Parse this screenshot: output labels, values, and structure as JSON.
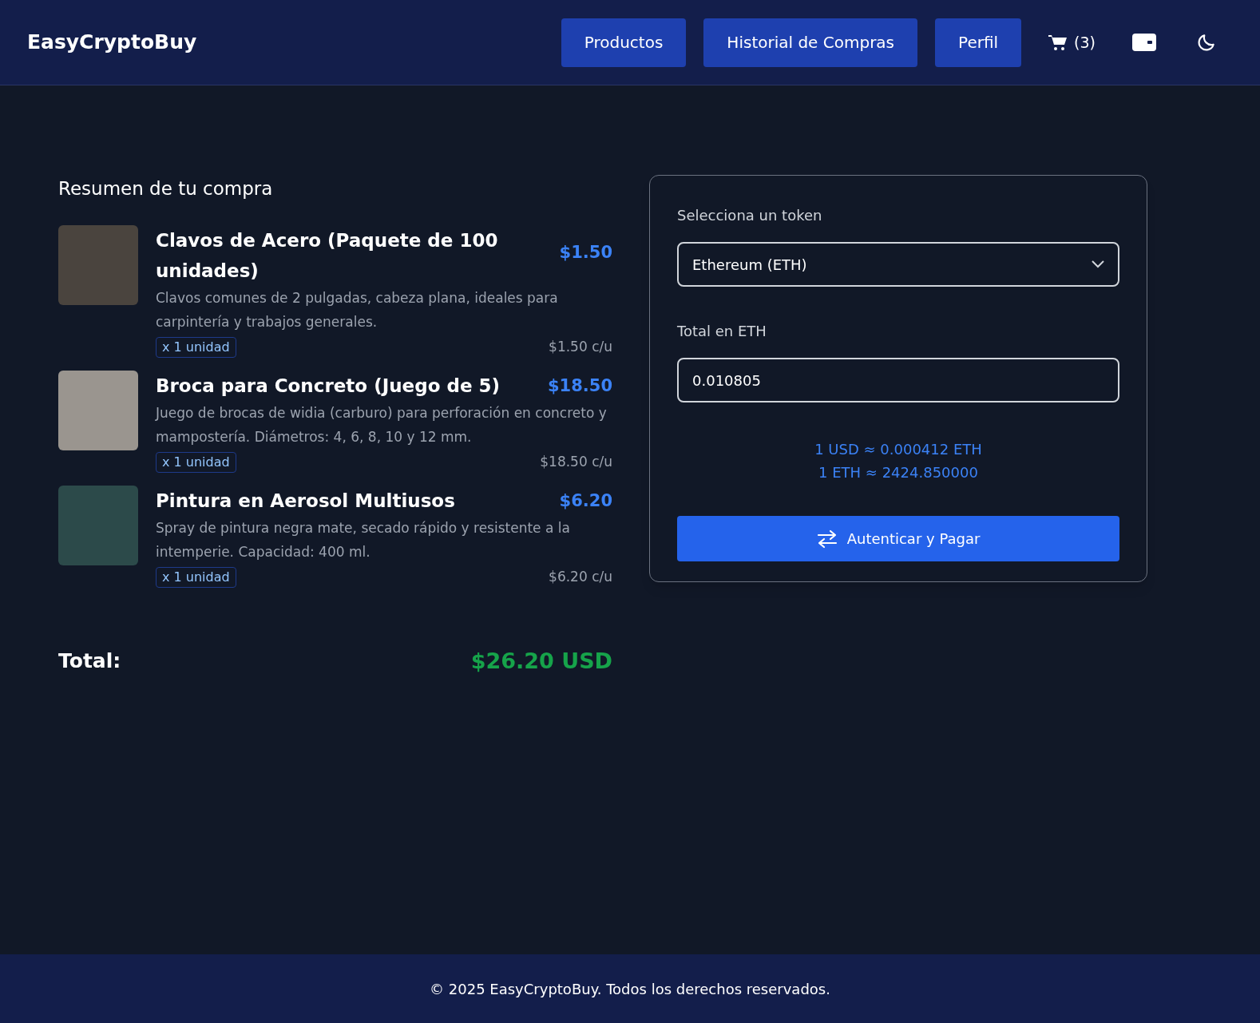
{
  "header": {
    "brand": "EasyCryptoBuy",
    "nav": [
      {
        "label": "Productos"
      },
      {
        "label": "Historial de Compras"
      },
      {
        "label": "Perfil"
      }
    ],
    "cart_count": "(3)"
  },
  "summary": {
    "title": "Resumen de tu compra",
    "items": [
      {
        "name": "Clavos de Acero (Paquete de 100 unidades)",
        "price": "$1.50",
        "description": "Clavos comunes de 2 pulgadas, cabeza plana, ideales para carpintería y trabajos generales.",
        "quantity": "x 1 unidad",
        "unit_price": "$1.50 c/u"
      },
      {
        "name": "Broca para Concreto (Juego de 5)",
        "price": "$18.50",
        "description": "Juego de brocas de widia (carburo) para perforación en concreto y mampostería. Diámetros: 4, 6, 8, 10 y 12 mm.",
        "quantity": "x 1 unidad",
        "unit_price": "$18.50 c/u"
      },
      {
        "name": "Pintura en Aerosol Multiusos",
        "price": "$6.20",
        "description": "Spray de pintura negra mate, secado rápido y resistente a la intemperie. Capacidad: 400 ml.",
        "quantity": "x 1 unidad",
        "unit_price": "$6.20 c/u"
      }
    ],
    "total_label": "Total:",
    "total_value": "$26.20 USD"
  },
  "payment": {
    "token_label": "Selecciona un token",
    "token_value": "Ethereum (ETH)",
    "total_label": "Total en ETH",
    "total_value": "0.010805",
    "rates": [
      "1 USD ≈ 0.000412 ETH",
      "1 ETH ≈ 2424.850000"
    ],
    "pay_button": "Autenticar y Pagar"
  },
  "footer": "© 2025 EasyCryptoBuy. Todos los derechos reservados."
}
